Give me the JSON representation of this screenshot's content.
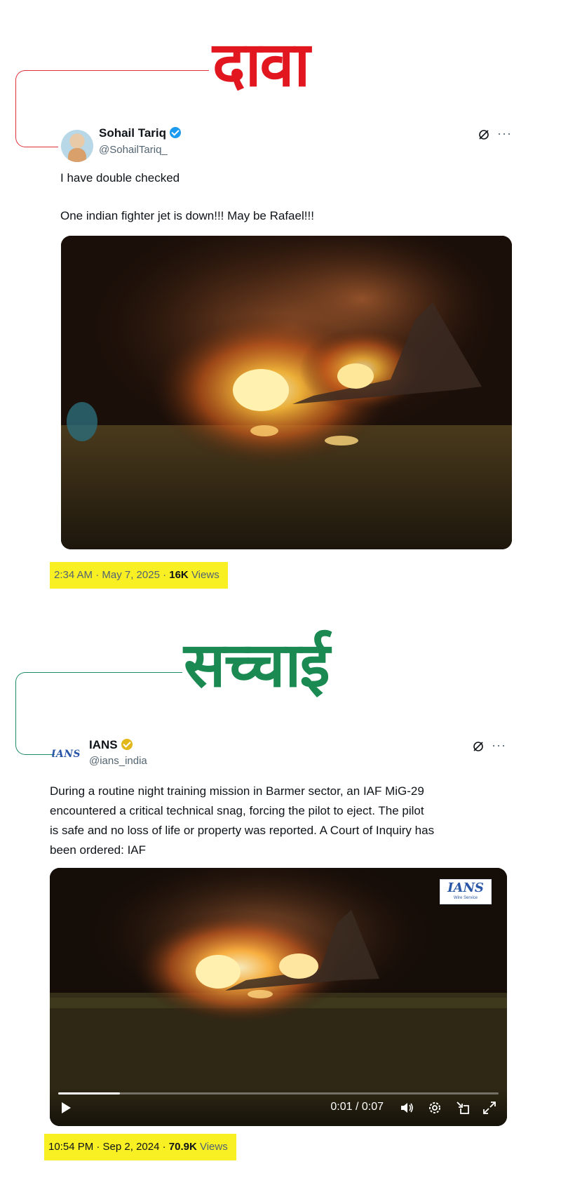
{
  "claim": {
    "heading": "दावा",
    "author_name": "Sohail Tariq",
    "author_handle": "@SohailTariq_",
    "verified": "blue",
    "text_line1": "I have double checked",
    "text_line2": "One indian fighter jet is down!!! May be Rafael!!!",
    "time": "2:34 AM · May 7, 2025 · ",
    "views_count": "16K",
    "views_label": " Views"
  },
  "fact": {
    "heading": "सच्चाई",
    "author_name": "IANS",
    "author_handle": "@ians_india",
    "avatar_text": "IANS",
    "verified": "gold",
    "text_lines": [
      "During a routine night training mission in Barmer sector, an IAF MiG-29",
      "encountered a critical technical snag, forcing the pilot to eject. The pilot",
      "is safe and no loss of life or property was reported. A Court of Inquiry has",
      "been ordered: IAF"
    ],
    "watermark_title": "IANS",
    "watermark_sub": "Wire Service",
    "video": {
      "current": "0:01",
      "duration": "0:07",
      "time_display": "0:01 / 0:07",
      "progress_fraction": 0.14
    },
    "time": "10:54 PM · Sep 2, 2024 · ",
    "views_count": "70.9K",
    "views_label": " Views"
  },
  "icons": {
    "grok": "grok-icon",
    "more": "more-icon",
    "play": "play-icon",
    "volume": "volume-icon",
    "settings": "settings-icon",
    "miniplayer": "miniplayer-icon",
    "fullscreen": "fullscreen-icon"
  },
  "colors": {
    "claim_accent": "#e2161f",
    "fact_accent": "#1a8a52",
    "highlight": "#f9f024",
    "verified_blue": "#1d9bf0",
    "verified_gold": "#e2b719"
  }
}
